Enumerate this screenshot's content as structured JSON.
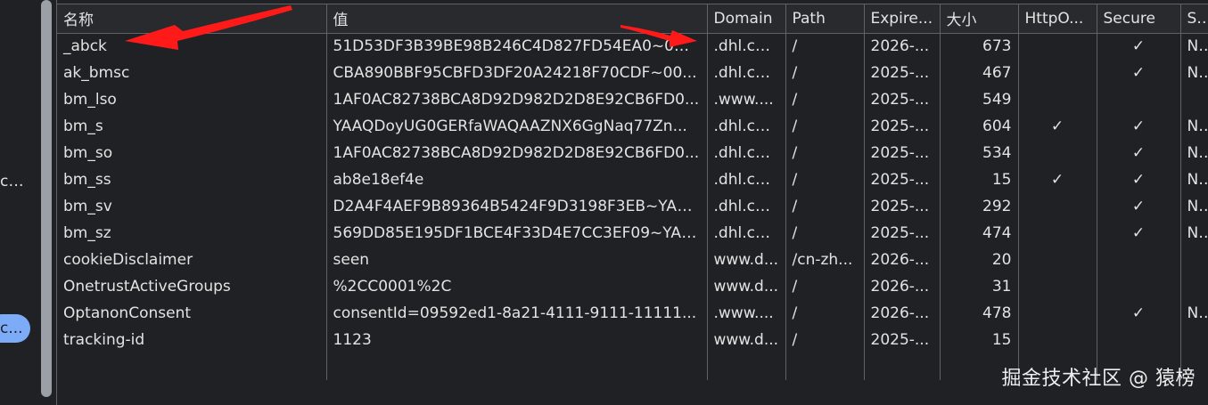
{
  "sidebar": {
    "truncated_item": "c...",
    "selected_pill": "c..."
  },
  "table": {
    "columns": [
      "名称",
      "值",
      "Domain",
      "Path",
      "Expire...",
      "大小",
      "HttpO...",
      "Secure",
      "Sam"
    ],
    "rows": [
      {
        "name": "_abck",
        "value": "51D53DF3B39BE98B246C4D827FD54EA0~0~...",
        "domain": ".dhl.com",
        "path": "/",
        "expires": "2026-...",
        "size": "673",
        "httponly": "",
        "secure": "✓",
        "samesite": "Non"
      },
      {
        "name": "ak_bmsc",
        "value": "CBA890BBF95CBFD3DF20A24218F70CDF~00...",
        "domain": ".dhl.com",
        "path": "/",
        "expires": "2025-...",
        "size": "467",
        "httponly": "",
        "secure": "✓",
        "samesite": "Non"
      },
      {
        "name": "bm_lso",
        "value": "1AF0AC82738BCA8D92D982D2D8E92CB6FD0...",
        "domain": ".www....",
        "path": "/",
        "expires": "2025-...",
        "size": "549",
        "httponly": "",
        "secure": "",
        "samesite": ""
      },
      {
        "name": "bm_s",
        "value": "YAAQDoyUG0GERfaWAQAAZNX6GgNaq77Zn...",
        "domain": ".dhl.com",
        "path": "/",
        "expires": "2025-...",
        "size": "604",
        "httponly": "✓",
        "secure": "✓",
        "samesite": "Non"
      },
      {
        "name": "bm_so",
        "value": "1AF0AC82738BCA8D92D982D2D8E92CB6FD0...",
        "domain": ".dhl.com",
        "path": "/",
        "expires": "2025-...",
        "size": "534",
        "httponly": "",
        "secure": "✓",
        "samesite": "Non"
      },
      {
        "name": "bm_ss",
        "value": "ab8e18ef4e",
        "domain": ".dhl.com",
        "path": "/",
        "expires": "2025-...",
        "size": "15",
        "httponly": "✓",
        "secure": "✓",
        "samesite": "Non"
      },
      {
        "name": "bm_sv",
        "value": "D2A4F4AEF9B89364B5424F9D3198F3EB~YAA...",
        "domain": ".dhl.com",
        "path": "/",
        "expires": "2025-...",
        "size": "292",
        "httponly": "",
        "secure": "✓",
        "samesite": "Non"
      },
      {
        "name": "bm_sz",
        "value": "569DD85E195DF1BCE4F33D4E7CC3EF09~YAA...",
        "domain": ".dhl.com",
        "path": "/",
        "expires": "2025-...",
        "size": "474",
        "httponly": "",
        "secure": "✓",
        "samesite": "Non"
      },
      {
        "name": "cookieDisclaimer",
        "value": "seen",
        "domain": "www.d...",
        "path": "/cn-zh...",
        "expires": "2026-...",
        "size": "20",
        "httponly": "",
        "secure": "",
        "samesite": ""
      },
      {
        "name": "OnetrustActiveGroups",
        "value": "%2CC0001%2C",
        "domain": "www.d...",
        "path": "/",
        "expires": "2026-...",
        "size": "31",
        "httponly": "",
        "secure": "",
        "samesite": ""
      },
      {
        "name": "OptanonConsent",
        "value": "consentId=09592ed1-8a21-4111-9111-11111...",
        "domain": ".www....",
        "path": "/",
        "expires": "2026-...",
        "size": "478",
        "httponly": "",
        "secure": "✓",
        "samesite": "Non"
      },
      {
        "name": "tracking-id",
        "value": "1123",
        "domain": "www.d...",
        "path": "/",
        "expires": "2025-...",
        "size": "15",
        "httponly": "",
        "secure": "",
        "samesite": ""
      }
    ]
  },
  "watermark": "掘金技术社区 @ 猿榜",
  "colors": {
    "background": "#202124",
    "grid_line": "#5f6368",
    "text": "#e3e3e3",
    "arrow": "#ff1a1a",
    "pill": "#7cacf8"
  }
}
